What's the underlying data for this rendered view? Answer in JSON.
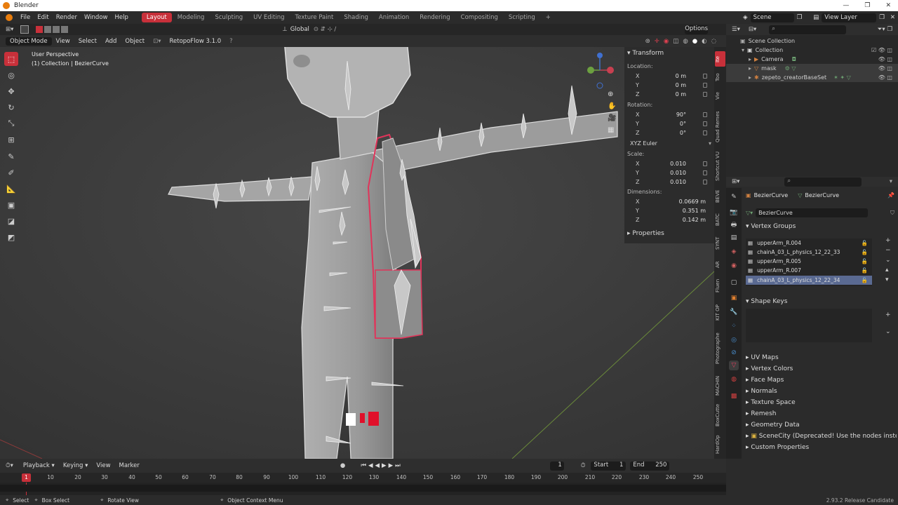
{
  "window": {
    "title": "Blender",
    "min": "—",
    "max": "❐",
    "close": "✕"
  },
  "menu": {
    "file": "File",
    "edit": "Edit",
    "render": "Render",
    "window": "Window",
    "help": "Help"
  },
  "workspaces": [
    "Layout",
    "Modeling",
    "Sculpting",
    "UV Editing",
    "Texture Paint",
    "Shading",
    "Animation",
    "Rendering",
    "Compositing",
    "Scripting"
  ],
  "add_workspace": "+",
  "scene": {
    "label": "Scene",
    "view_layer": "View Layer"
  },
  "viewport_top": {
    "orientation": "Global",
    "options": "Options"
  },
  "viewport_header": {
    "mode": "Object Mode",
    "view": "View",
    "select": "Select",
    "add": "Add",
    "object": "Object",
    "addon": "RetopoFlow 3.1.0",
    "help": "?"
  },
  "viewport_info": {
    "line1": "User Perspective",
    "line2": "(1) Collection | BezierCurve"
  },
  "transform": {
    "title": "Transform",
    "location_label": "Location:",
    "location": [
      {
        "axis": "X",
        "value": "0 m"
      },
      {
        "axis": "Y",
        "value": "0 m"
      },
      {
        "axis": "Z",
        "value": "0 m"
      }
    ],
    "rotation_label": "Rotation:",
    "rotation": [
      {
        "axis": "X",
        "value": "90°"
      },
      {
        "axis": "Y",
        "value": "0°"
      },
      {
        "axis": "Z",
        "value": "0°"
      }
    ],
    "rotation_mode": "XYZ Euler",
    "scale_label": "Scale:",
    "scale": [
      {
        "axis": "X",
        "value": "0.010"
      },
      {
        "axis": "Y",
        "value": "0.010"
      },
      {
        "axis": "Z",
        "value": "0.010"
      }
    ],
    "dimensions_label": "Dimensions:",
    "dimensions": [
      {
        "axis": "X",
        "value": "0.0669 m"
      },
      {
        "axis": "Y",
        "value": "0.351 m"
      },
      {
        "axis": "Z",
        "value": "0.142 m"
      }
    ],
    "properties": "Properties"
  },
  "side_tabs": [
    "Ite",
    "Too",
    "Vie",
    "Quad Remes",
    "Shortcut VU",
    "BEVE",
    "BATC",
    "SYNT",
    "AR",
    "Fluen",
    "KIT OP",
    "Photographe",
    "MACHIN",
    "BoxCutte",
    "HardOp"
  ],
  "outliner": {
    "root": "Scene Collection",
    "items": [
      {
        "name": "Collection",
        "indent": 0
      },
      {
        "name": "Camera",
        "indent": 1
      },
      {
        "name": "mask",
        "indent": 1
      },
      {
        "name": "zepeto_creatorBaseSet",
        "indent": 1
      }
    ]
  },
  "props": {
    "object_name": "BezierCurve",
    "data_name": "BezierCurve",
    "data_field": "BezierCurve",
    "vertex_groups_title": "Vertex Groups",
    "vertex_groups": [
      "upperArm_R.004",
      "chainA_03_L_physics_12_22_33",
      "upperArm_R.005",
      "upperArm_R.007",
      "chainA_03_L_physics_12_22_34"
    ],
    "shape_keys_title": "Shape Keys",
    "sections": [
      "UV Maps",
      "Vertex Colors",
      "Face Maps",
      "Normals",
      "Texture Space",
      "Remesh",
      "Geometry Data",
      "SceneCity (Deprecated! Use the nodes instead",
      "Custom Properties"
    ]
  },
  "timeline": {
    "playback": "Playback",
    "keying": "Keying",
    "view": "View",
    "marker": "Marker",
    "current_frame": "1",
    "start_label": "Start",
    "start": "1",
    "end_label": "End",
    "end": "250",
    "ticks": [
      "10",
      "20",
      "30",
      "40",
      "50",
      "60",
      "70",
      "80",
      "90",
      "100",
      "110",
      "120",
      "130",
      "140",
      "150",
      "160",
      "170",
      "180",
      "190",
      "200",
      "210",
      "220",
      "230",
      "240",
      "250"
    ],
    "playhead": "1"
  },
  "statusbar": {
    "select": "Select",
    "box_select": "Box Select",
    "rotate": "Rotate View",
    "context": "Object Context Menu",
    "version": "2.93.2 Release Candidate"
  },
  "colors": {
    "accent": "#c8303a",
    "selection": "#5a6a92",
    "outline": "#e0345a"
  }
}
